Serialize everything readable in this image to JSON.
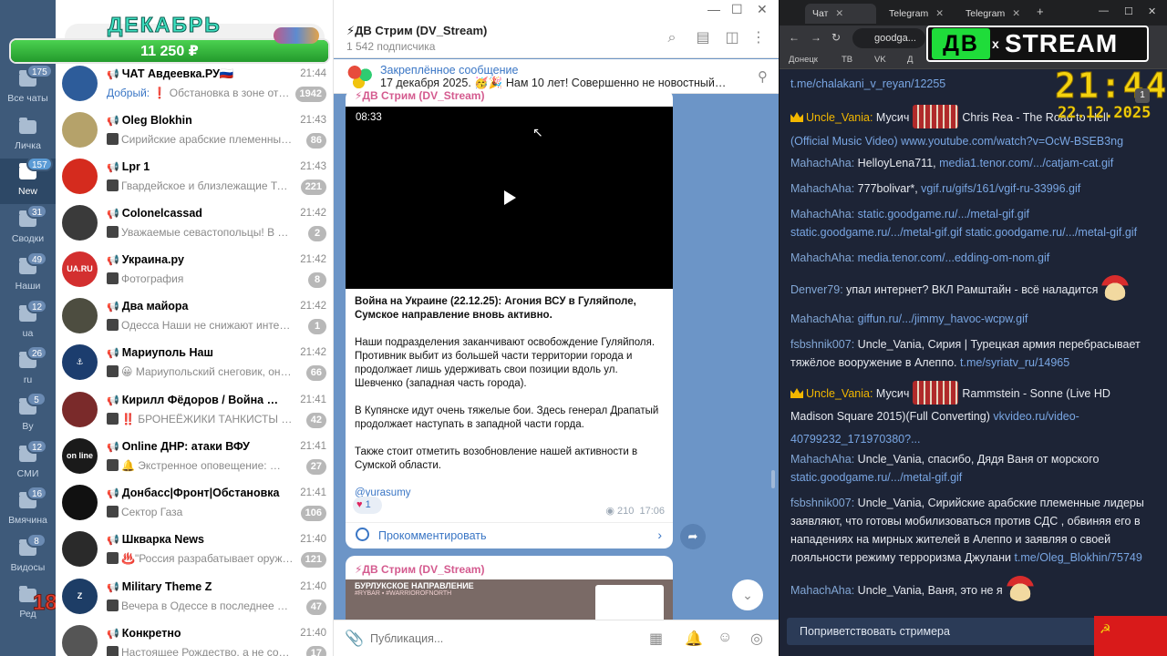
{
  "telegram": {
    "folders": [
      {
        "label": "Все чаты",
        "badge": "175",
        "icon": "chats-icon"
      },
      {
        "label": "Личка",
        "badge": "",
        "icon": "folder-icon"
      },
      {
        "label": "New",
        "badge": "157",
        "icon": "folder-icon"
      },
      {
        "label": "Сводки",
        "badge": "31",
        "icon": "folder-icon"
      },
      {
        "label": "Наши",
        "badge": "49",
        "icon": "folder-icon"
      },
      {
        "label": "ua",
        "badge": "12",
        "icon": "folder-icon"
      },
      {
        "label": "ru",
        "badge": "26",
        "icon": "folder-icon"
      },
      {
        "label": "By",
        "badge": "5",
        "icon": "folder-icon"
      },
      {
        "label": "СМИ",
        "badge": "12",
        "icon": "folder-icon"
      },
      {
        "label": "Вмячина",
        "badge": "16",
        "icon": "folder-icon"
      },
      {
        "label": "Видосы",
        "badge": "8",
        "icon": "folder-icon"
      },
      {
        "label": "Ред",
        "badge": "",
        "icon": "edit-icon"
      }
    ],
    "active_folder": "New",
    "age_badge": "18+",
    "promo": {
      "title": "ДЕКАБРЬ",
      "amount": "11 250 ₽",
      "fill": 1.0
    },
    "chats": [
      {
        "title": "ЧАТ Авдеевка.РУ🇷🇺",
        "time": "21:44",
        "sender": "Добрый:",
        "preview": "❗ Обстановка в зоне ответс...",
        "unread": "1942",
        "avatar_color": "#2d5c9a",
        "avatar_text": ""
      },
      {
        "title": "Oleg Blokhin",
        "time": "21:43",
        "sender": "",
        "preview": "Сирийские арабские племенные ...",
        "unread": "86",
        "avatar_color": "#b5a26a",
        "avatar_text": ""
      },
      {
        "title": "Lpr 1",
        "time": "21:43",
        "sender": "",
        "preview": "Гвардейское и близлежащие  Тревога ...",
        "unread": "221",
        "avatar_color": "#d52b1e",
        "avatar_text": ""
      },
      {
        "title": "Colonelcassad",
        "time": "21:42",
        "sender": "",
        "preview": "Уважаемые севастопольцы!  В Севастоп...",
        "unread": "2",
        "avatar_color": "#3a3a3a",
        "avatar_text": ""
      },
      {
        "title": "Украина.ру",
        "time": "21:42",
        "sender": "",
        "preview": "Фотография",
        "unread": "8",
        "avatar_color": "#d32f2f",
        "avatar_text": "UA.RU"
      },
      {
        "title": "Два майора",
        "time": "21:42",
        "sender": "",
        "preview": "Одесса  Наши не снижают интенсивн...",
        "unread": "1",
        "avatar_color": "#4d4d40",
        "avatar_text": ""
      },
      {
        "title": "Мариуполь Наш",
        "time": "21:42",
        "sender": "",
        "preview": "😀 Мариупольский снеговик, он так...",
        "unread": "66",
        "avatar_color": "#1c3d6e",
        "avatar_text": "⚓"
      },
      {
        "title": "Кирилл Фёдоров / Война История ...",
        "time": "21:41",
        "sender": "",
        "preview": "‼️ БРОНЕЁЖИКИ ТАНКИСТЫ ПРОСЯ...",
        "unread": "42",
        "avatar_color": "#7a2a2a",
        "avatar_text": ""
      },
      {
        "title": "Online ДНР: атаки ВФУ",
        "time": "21:41",
        "sender": "",
        "preview": "🔔 Экстренное оповещение: ▶️ДН...",
        "unread": "27",
        "avatar_color": "#1a1a1a",
        "avatar_text": "on line"
      },
      {
        "title": "Донбасс|Фронт|Обстановка",
        "time": "21:41",
        "sender": "",
        "preview": "Сектор Газа",
        "unread": "106",
        "avatar_color": "#111111",
        "avatar_text": ""
      },
      {
        "title": "Шкварка News",
        "time": "21:40",
        "sender": "",
        "preview": "♨️\"Россия разрабатывает оружие ...",
        "unread": "121",
        "avatar_color": "#2a2a2a",
        "avatar_text": ""
      },
      {
        "title": "Military Theme Z",
        "time": "21:40",
        "sender": "",
        "preview": "Вечера в Одессе в последнее время ...",
        "unread": "47",
        "avatar_color": "#1d3d66",
        "avatar_text": "Z"
      },
      {
        "title": "Конкретно",
        "time": "21:40",
        "sender": "",
        "preview": "Настоящее Рождество, а не советск...",
        "unread": "17",
        "avatar_color": "#555555",
        "avatar_text": ""
      }
    ],
    "channel": {
      "title": "⚡ДВ Стрим (DV_Stream)",
      "subscribers": "1 542 подписчика",
      "pinned_title": "Закреплённое сообщение",
      "pinned_text": "17 декабря 2025. 🥳🎉 Нам 10 лет! Совершенно не новостный, но в чё...",
      "post1": {
        "author": "⚡ДВ Стрим (DV_Stream)",
        "video_time": "08:33",
        "headline": "Война на Украине (22.12.25): Агония ВСУ в Гуляйполе, Сумское направление вновь активно.",
        "para1": "Наши подразделения заканчивают освобождение Гуляйполя. Противник выбит из большей части территории города и продолжает лишь удерживать свои позиции вдоль ул. Шевченко (западная часть города).",
        "para2": "В Купянске идут очень тяжелые бои. Здесь генерал Драпатый продолжает наступать в западной части горда.",
        "para3": "Также стоит отметить возобновление нашей активности в Сумской области.",
        "link": "@yurasumy",
        "reaction_count": "1",
        "views": "210",
        "time": "17:06",
        "comment_label": "Прокомментировать"
      },
      "post2": {
        "author": "⚡ДВ Стрим (DV_Stream)",
        "map_title": "БУРЛУКСКОЕ НАПРАВЛЕНИЕ",
        "map_sub": "#RYBAR ▪ #WARRIOROFNORTH"
      },
      "composer_placeholder": "Публикация..."
    }
  },
  "browser": {
    "tabs": [
      {
        "label": "Чат",
        "active": true
      },
      {
        "label": "Telegram",
        "active": false
      },
      {
        "label": "Telegram",
        "active": false
      }
    ],
    "url": "goodga...",
    "bookmarks": [
      "Донецк",
      "ТВ",
      "VK",
      "Д"
    ],
    "overlay": {
      "logo_dv": "ДВ",
      "logo_x": "x",
      "logo_stream": "STREAM",
      "clock": "21:44",
      "date": "22.12.2025",
      "viewer_count": "1"
    },
    "stream_chat": {
      "messages": [
        {
          "nick": "",
          "text": "",
          "link": "t.me/chalakani_v_reyan/12255"
        },
        {
          "nick": "Uncle_Vania:",
          "gold": true,
          "text": "Мусич",
          "after": "Chris Rea - The Road to Hell",
          "link": "(Official Music Video) www.youtube.com/watch?v=OcW-BSEB3ng"
        },
        {
          "nick": "MahachAha:",
          "text": "HelloyLena711,",
          "link": "media1.tenor.com/.../catjam-cat.gif"
        },
        {
          "nick": "MahachAha:",
          "text": "777bolivar*,",
          "link": "vgif.ru/gifs/161/vgif-ru-33996.gif"
        },
        {
          "nick": "MahachAha:",
          "text": "",
          "link": "static.goodgame.ru/.../metal-gif.gif static.goodgame.ru/.../metal-gif.gif static.goodgame.ru/.../metal-gif.gif"
        },
        {
          "nick": "MahachAha:",
          "text": "",
          "link": "media.tenor.com/...edding-om-nom.gif"
        },
        {
          "nick": "Denver79:",
          "text": "упал интернет? ВКЛ Рамштайн - всё наладится",
          "link": ""
        },
        {
          "nick": "MahachAha:",
          "text": "",
          "link": "giffun.ru/.../jimmy_havoc-wcpw.gif"
        },
        {
          "nick": "fsbshnik007:",
          "text": "Uncle_Vania, Сирия | Турецкая армия перебрасывает тяжёлое вооружение в Алеппо.",
          "link": "t.me/syriatv_ru/14965"
        },
        {
          "nick": "Uncle_Vania:",
          "gold": true,
          "text": "Мусич",
          "after": "Rammstein - Sonne (Live HD Madison Square 2015)(Full Converting)",
          "link": "vkvideo.ru/video-40799232_171970380?..."
        },
        {
          "nick": "MahachAha:",
          "text": "Uncle_Vania, спасибо, Дядя Ваня от морского",
          "link": "static.goodgame.ru/.../metal-gif.gif"
        },
        {
          "nick": "fsbshnik007:",
          "text": "Uncle_Vania, Сирийские арабские племенные лидеры заявляют, что готовы мобилизоваться против СДС , обвиняя его в нападениях на мирных жителей в Алеппо и заявляя о своей лояльности режиму терроризма Джулани",
          "link": "t.me/Oleg_Blokhin/75749"
        },
        {
          "nick": "MahachAha:",
          "text": "Uncle_Vania, Ваня, это не я",
          "link": ""
        }
      ],
      "greet_button": "Поприветствовать стримера",
      "flag_symbol": "☭"
    }
  }
}
